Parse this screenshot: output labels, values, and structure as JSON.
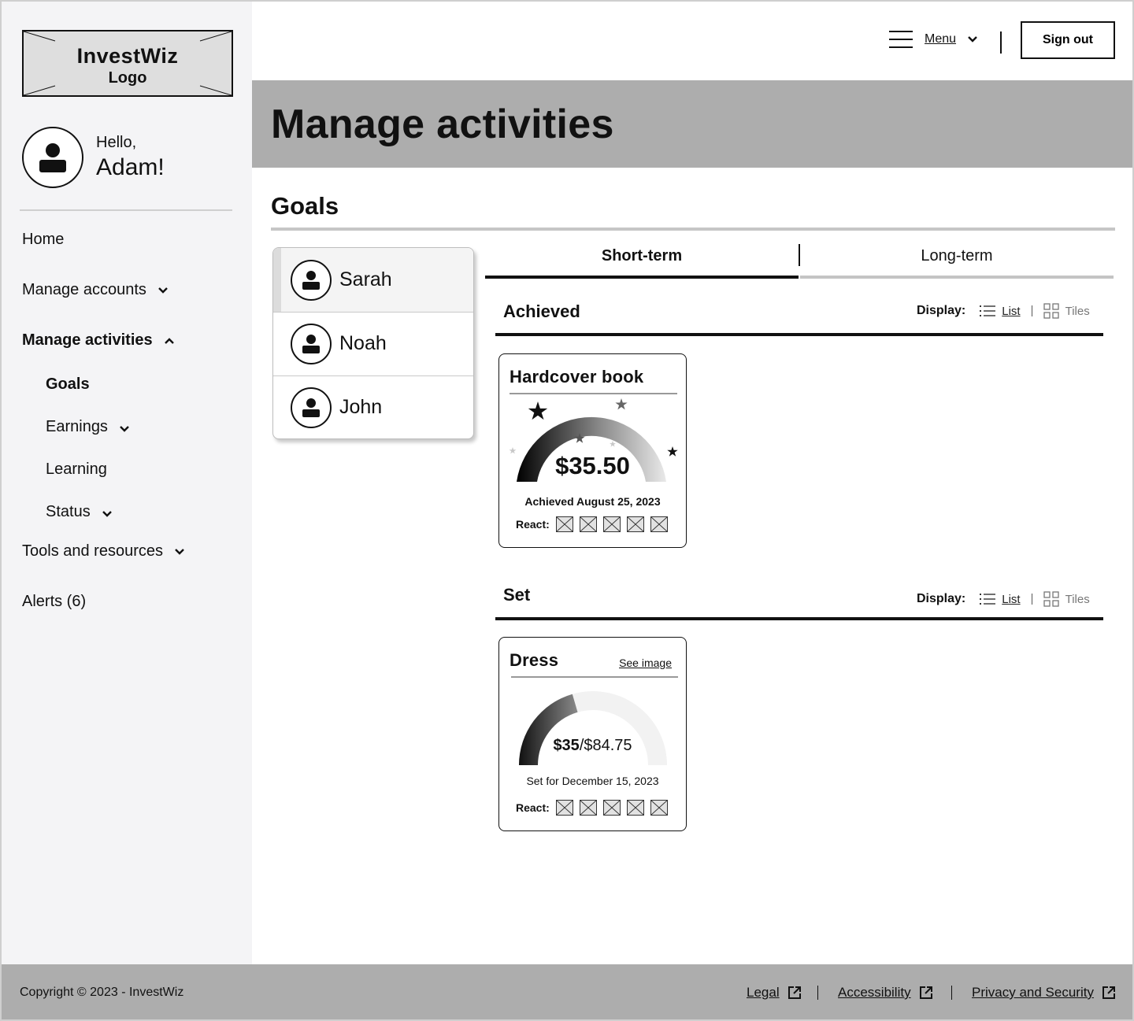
{
  "brand": {
    "name": "InvestWiz",
    "logo_caption": "Logo"
  },
  "greeting": {
    "hello": "Hello,",
    "name": "Adam!"
  },
  "nav": {
    "home": "Home",
    "manage_accounts": "Manage accounts",
    "manage_activities": "Manage activities",
    "goals": "Goals",
    "earnings": "Earnings",
    "learning": "Learning",
    "status": "Status",
    "tools": "Tools and resources",
    "alerts": "Alerts (6)"
  },
  "header": {
    "menu_label": "Menu",
    "signout_label": "Sign out"
  },
  "page": {
    "title": "Manage activities",
    "section_title": "Goals"
  },
  "people": [
    {
      "name": "Sarah",
      "selected": true
    },
    {
      "name": "Noah",
      "selected": false
    },
    {
      "name": "John",
      "selected": false
    }
  ],
  "tabs": {
    "short_term": "Short-term",
    "long_term": "Long-term",
    "active": "Short-term"
  },
  "display": {
    "label": "Display:",
    "list": "List",
    "tiles": "Tiles",
    "active": "List"
  },
  "achieved": {
    "title": "Achieved",
    "card": {
      "title": "Hardcover book",
      "amount": "$35.50",
      "date": "Achieved August 25, 2023",
      "react_label": "React:",
      "progress": 1.0
    }
  },
  "set": {
    "title": "Set",
    "card": {
      "title": "Dress",
      "see_image": "See image",
      "amount_saved": "$35",
      "amount_goal": "/$84.75",
      "date": "Set for December 15, 2023",
      "react_label": "React:",
      "progress": 0.41
    }
  },
  "footer": {
    "copyright": "Copyright © 2023 - InvestWiz",
    "legal": "Legal",
    "accessibility": "Accessibility",
    "privacy": "Privacy and Security"
  },
  "colors": {
    "sidebar_bg": "#f4f4f6",
    "banner_bg": "#adadad",
    "footer_bg": "#adadad"
  }
}
